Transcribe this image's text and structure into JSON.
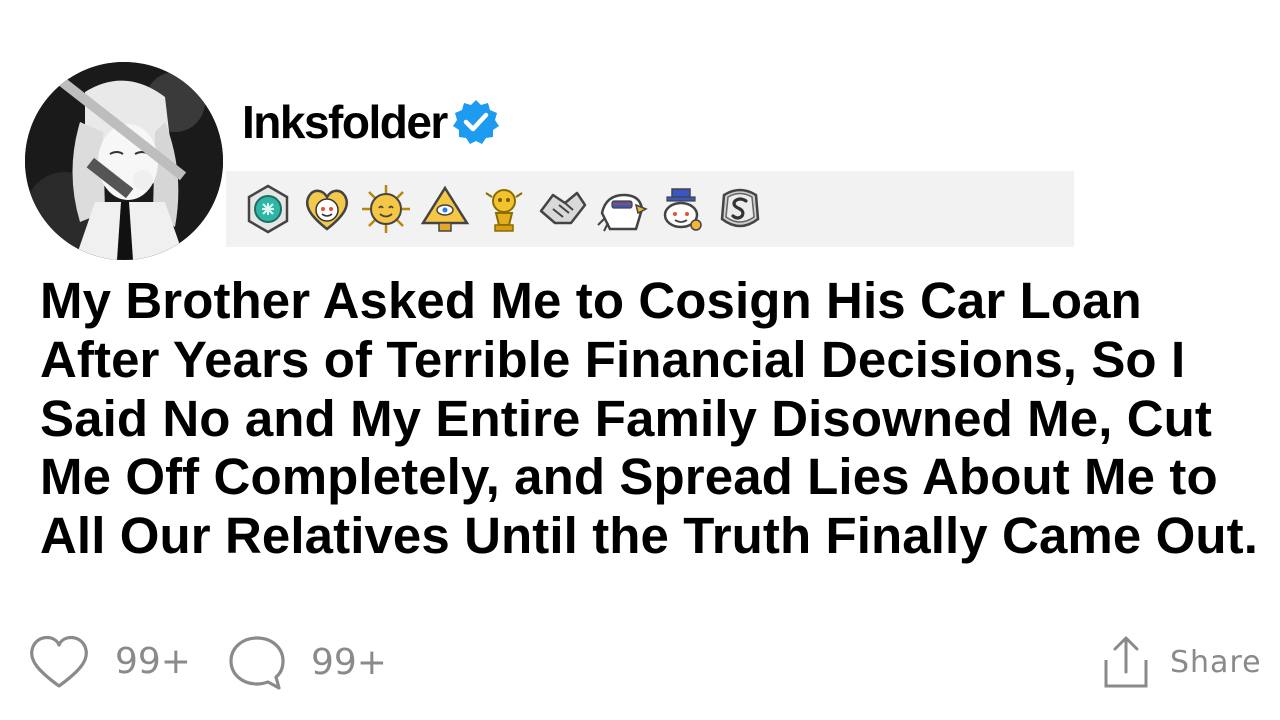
{
  "post": {
    "author": "Inksfolder",
    "verified": true,
    "title": "My Brother Asked Me to Cosign His Car Loan After Years of Terrible Financial Decisions, So I Said No and My Entire Family Disowned Me, Cut Me Off Completely, and Spread Lies About Me to All Our Relatives Until the Truth Finally Came Out."
  },
  "awards": [
    "helpful-award-icon",
    "wholesome-award-icon",
    "sun-award-icon",
    "illuminati-award-icon",
    "gold-trophy-award-icon",
    "handshake-award-icon",
    "eagle-award-icon",
    "snoo-award-icon",
    "silver-award-icon"
  ],
  "actions": {
    "likes": "99+",
    "comments": "99+",
    "share_label": "Share"
  },
  "colors": {
    "verified": "#1d9bf0",
    "muted": "#8a8a8a",
    "awards_bg": "#f2f2f2"
  }
}
